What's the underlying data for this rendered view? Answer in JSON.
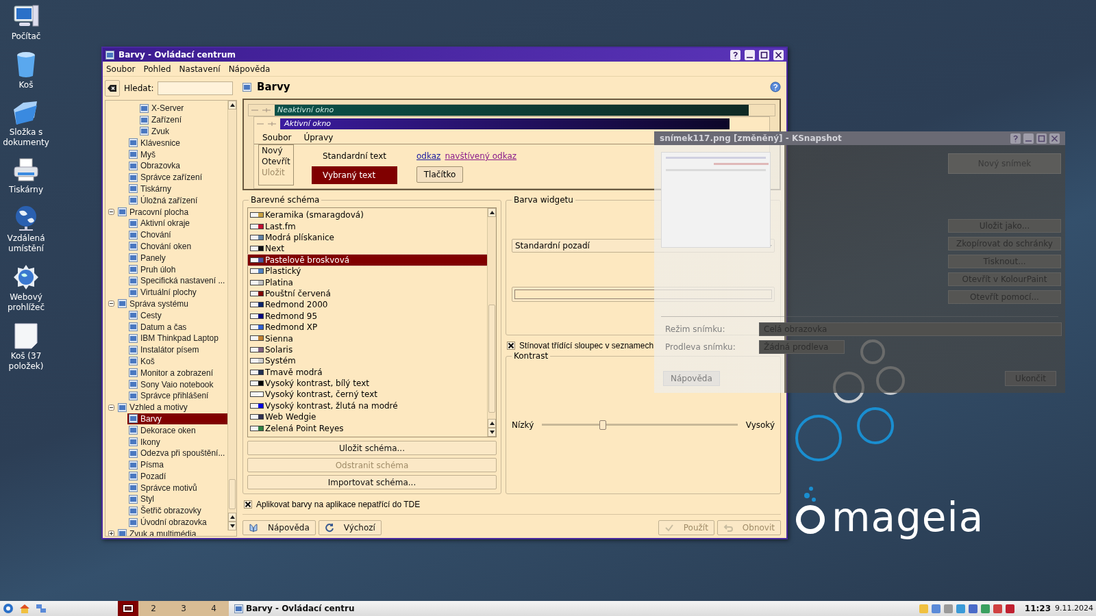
{
  "desktop_icons": [
    {
      "label": "Počítač",
      "kind": "computer"
    },
    {
      "label": "Koš",
      "kind": "trash"
    },
    {
      "label": "Složka s dokumenty",
      "kind": "folder"
    },
    {
      "label": "Tiskárny",
      "kind": "printer"
    },
    {
      "label": "Vzdálená umístění",
      "kind": "network"
    },
    {
      "label": "Webový prohlížeč",
      "kind": "browser"
    },
    {
      "label": "Koš (37 položek)",
      "kind": "page"
    }
  ],
  "window": {
    "title": "Barvy - Ovládací centrum",
    "menu": [
      "Soubor",
      "Pohled",
      "Nastavení",
      "Nápověda"
    ],
    "search": {
      "label": "Hledat:"
    },
    "tree": [
      {
        "children": [
          {
            "children": [
              {
                "label": "X-Server",
                "selected": false
              },
              {
                "label": "Zařízení",
                "selected": false
              },
              {
                "label": "Zvuk",
                "selected": false
              }
            ]
          },
          {
            "label": "Klávesnice",
            "selected": false
          },
          {
            "label": "Myš",
            "selected": false
          },
          {
            "label": "Obrazovka",
            "selected": false
          },
          {
            "label": "Správce zařízení",
            "selected": false
          },
          {
            "label": "Tiskárny",
            "selected": false
          },
          {
            "label": "Úložná zařízení",
            "selected": false
          }
        ]
      },
      {
        "label": "Pracovní plocha",
        "selected": false,
        "expanded": true,
        "children": [
          {
            "label": "Aktivní okraje",
            "selected": false
          },
          {
            "label": "Chování",
            "selected": false
          },
          {
            "label": "Chování oken",
            "selected": false
          },
          {
            "label": "Panely",
            "selected": false
          },
          {
            "label": "Pruh úloh",
            "selected": false
          },
          {
            "label": "Specifická nastavení ...",
            "selected": false
          },
          {
            "label": "Virtuální plochy",
            "selected": false
          }
        ]
      },
      {
        "label": "Správa systému",
        "selected": false,
        "expanded": true,
        "children": [
          {
            "label": "Cesty",
            "selected": false
          },
          {
            "label": "Datum a čas",
            "selected": false
          },
          {
            "label": "IBM Thinkpad Laptop",
            "selected": false
          },
          {
            "label": "Instalátor písem",
            "selected": false
          },
          {
            "label": "Koš",
            "selected": false
          },
          {
            "label": "Monitor a zobrazení",
            "selected": false
          },
          {
            "label": "Sony Vaio notebook",
            "selected": false
          },
          {
            "label": "Správce přihlášení",
            "selected": false
          }
        ]
      },
      {
        "label": "Vzhled a motivy",
        "selected": false,
        "expanded": true,
        "children": [
          {
            "label": "Barvy",
            "selected": true
          },
          {
            "label": "Dekorace oken",
            "selected": false
          },
          {
            "label": "Ikony",
            "selected": false
          },
          {
            "label": "Odezva při spouštění...",
            "selected": false
          },
          {
            "label": "Písma",
            "selected": false
          },
          {
            "label": "Pozadí",
            "selected": false
          },
          {
            "label": "Správce motivů",
            "selected": false
          },
          {
            "label": "Styl",
            "selected": false
          },
          {
            "label": "Šetřič obrazovky",
            "selected": false
          },
          {
            "label": "Úvodní obrazovka",
            "selected": false
          }
        ]
      },
      {
        "label": "Zvuk a multimédia",
        "selected": false,
        "expanded": false
      }
    ],
    "page_title": "Barvy",
    "preview": {
      "inactive_title": "Neaktivní okno",
      "active_title": "Aktivní okno",
      "menu": [
        "Soubor",
        "Úpravy"
      ],
      "popup": [
        {
          "label": "Nový",
          "disabled": false
        },
        {
          "label": "Otevřít",
          "disabled": false
        },
        {
          "label": "Uložit",
          "disabled": true
        }
      ],
      "standard_text": "Standardní text",
      "selected_text": "Vybraný text",
      "link": "odkaz",
      "visited_link": "navštívený odkaz",
      "button": "Tlačítko"
    },
    "scheme_group": {
      "title": "Barevné schéma",
      "items": [
        {
          "label": "Keramika (smaragdová)",
          "color": "#c8a040",
          "selected": false
        },
        {
          "label": "Last.fm",
          "color": "#c01030",
          "selected": false
        },
        {
          "label": "Modrá plískanice",
          "color": "#6080a0",
          "selected": false
        },
        {
          "label": "Next",
          "color": "#101010",
          "selected": false
        },
        {
          "label": "Pastelově broskvová",
          "color": "#5050a0",
          "selected": true
        },
        {
          "label": "Plastický",
          "color": "#5080c0",
          "selected": false
        },
        {
          "label": "Platina",
          "color": "#c0c0c0",
          "selected": false
        },
        {
          "label": "Pouštní červená",
          "color": "#800000",
          "selected": false
        },
        {
          "label": "Redmond 2000",
          "color": "#0a246a",
          "selected": false
        },
        {
          "label": "Redmond 95",
          "color": "#000080",
          "selected": false
        },
        {
          "label": "Redmond XP",
          "color": "#3060d0",
          "selected": false
        },
        {
          "label": "Sienna",
          "color": "#c08030",
          "selected": false
        },
        {
          "label": "Solaris",
          "color": "#806080",
          "selected": false
        },
        {
          "label": "Systém",
          "color": "#d0d0d0",
          "selected": false
        },
        {
          "label": "Tmavě modrá",
          "color": "#203050",
          "selected": false
        },
        {
          "label": "Vysoký kontrast, bílý text",
          "color": "#000000",
          "selected": false
        },
        {
          "label": "Vysoký kontrast, černý text",
          "color": "#ffffff",
          "selected": false
        },
        {
          "label": "Vysoký kontrast, žlutá na modré",
          "color": "#0000e0",
          "selected": false
        },
        {
          "label": "Web Wedgie",
          "color": "#303050",
          "selected": false
        },
        {
          "label": "Zelená Point Reyes",
          "color": "#308040",
          "selected": false
        }
      ],
      "buttons": [
        {
          "label": "Uložit schéma...",
          "disabled": false
        },
        {
          "label": "Odstranit schéma",
          "disabled": true
        },
        {
          "label": "Importovat schéma...",
          "disabled": false
        }
      ]
    },
    "widget_group": {
      "title": "Barva widgetu",
      "combo": "Standardní pozadí"
    },
    "shade_checkbox": {
      "label": "Stínovat třídící sloupec v seznamech",
      "checked": true
    },
    "contrast": {
      "title": "Kontrast",
      "low": "Nízký",
      "high": "Vysoký",
      "level": 0.31
    },
    "apply_checkbox": {
      "label": "Aplikovat barvy na aplikace nepatřící do TDE",
      "checked": true
    },
    "buttons": [
      {
        "label": "Nápověda",
        "kind": "help",
        "disabled": false
      },
      {
        "label": "Výchozí",
        "kind": "reset",
        "disabled": false
      },
      {
        "label": "Použít",
        "kind": "apply",
        "disabled": true
      },
      {
        "label": "Obnovit",
        "kind": "revert",
        "disabled": true
      }
    ]
  },
  "ghost_window": {
    "title": "snímek117.png [změněný] - KSnapshot",
    "new_button": "Nový snímek",
    "actions": [
      "Uložit jako...",
      "Zkopírovat do schránky",
      "Tisknout...",
      "Otevřít v KolourPaint",
      "Otevřít pomocí..."
    ],
    "mode_label": "Režim snímku:",
    "mode_value": "Celá obrazovka",
    "delay_label": "Prodleva snímku:",
    "delay_value": "Žádná prodleva",
    "help": "Nápověda",
    "quit": "Ukončit"
  },
  "logo": "mageia",
  "taskbar": {
    "desktops": [
      {
        "selected": true
      },
      {
        "label": "2",
        "selected": false
      },
      {
        "label": "3",
        "selected": false
      },
      {
        "label": "4",
        "selected": false
      }
    ],
    "task": "Barvy - Ovládací centru",
    "time": "11:23",
    "date": "9.11.2024"
  }
}
